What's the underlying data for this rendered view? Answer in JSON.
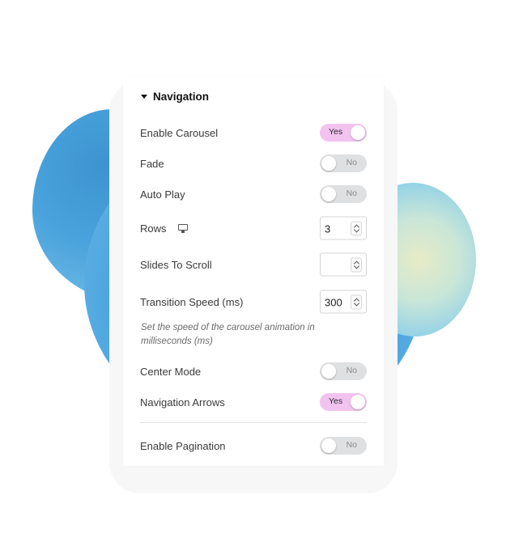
{
  "section": {
    "title": "Navigation"
  },
  "enable_carousel": {
    "label": "Enable Carousel",
    "value": "Yes"
  },
  "fade": {
    "label": "Fade",
    "value": "No"
  },
  "auto_play": {
    "label": "Auto Play",
    "value": "No"
  },
  "rows": {
    "label": "Rows",
    "value": "3",
    "device_icon": "monitor-icon"
  },
  "slides_to_scroll": {
    "label": "Slides To Scroll",
    "value": ""
  },
  "transition_speed": {
    "label": "Transition Speed (ms)",
    "value": "300",
    "description": "Set the speed of the carousel animation in milliseconds (ms)"
  },
  "center_mode": {
    "label": "Center Mode",
    "value": "No"
  },
  "navigation_arrows": {
    "label": "Navigation Arrows",
    "value": "Yes"
  },
  "enable_pagination": {
    "label": "Enable Pagination",
    "value": "No"
  },
  "colors": {
    "toggle_on": "#f3c3f0",
    "toggle_off": "#dfe0e2",
    "blob_blue": "#4aa3dc",
    "blob_yellow": "#e7ebc6"
  }
}
